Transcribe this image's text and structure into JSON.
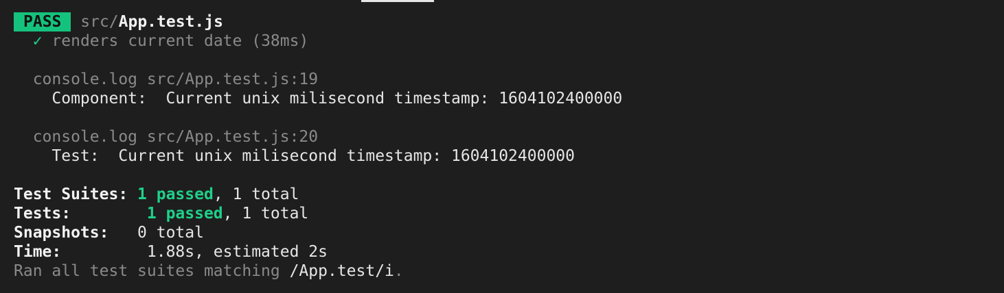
{
  "header": {
    "badge": "PASS",
    "path_prefix": "src/",
    "file_name": "App.test.js"
  },
  "test_result": {
    "check_mark": "✓",
    "name": "renders current date",
    "duration": "(38ms)"
  },
  "logs": [
    {
      "source": "console.log src/App.test.js:19",
      "message": "Component:  Current unix milisecond timestamp: 1604102400000"
    },
    {
      "source": "console.log src/App.test.js:20",
      "message": "Test:  Current unix milisecond timestamp: 1604102400000"
    }
  ],
  "summary": {
    "suites_label": "Test Suites:",
    "suites_passed": "1 passed",
    "suites_total": ", 1 total",
    "tests_label": "Tests:",
    "tests_passed": "1 passed",
    "tests_total": ", 1 total",
    "snapshots_label": "Snapshots:",
    "snapshots_value": "0 total",
    "time_label": "Time:",
    "time_value": "1.88s, estimated 2s",
    "ran_prefix": "Ran all test suites matching ",
    "ran_pattern": "/App.test/i",
    "ran_suffix": "."
  },
  "colors": {
    "background": "#1e1e1e",
    "pass_badge": "#15c27d",
    "passed_text": "#1fd08a",
    "dim_text": "#8a8a8a",
    "default_text": "#e6e6e6"
  }
}
